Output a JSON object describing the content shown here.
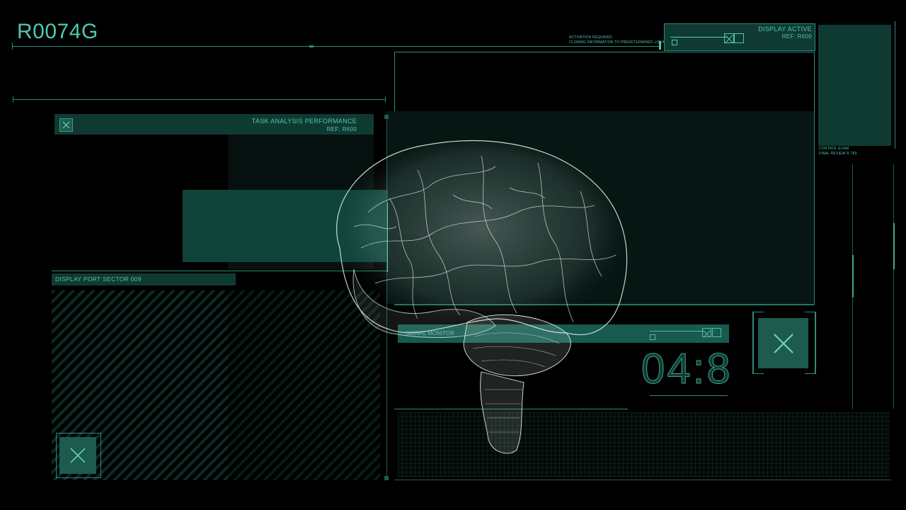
{
  "header": {
    "code": "R0074G"
  },
  "top_notice": {
    "line1": "ACTIVATION REQUIRED",
    "line2": "CLONING INFORMATION TO PREDETERMINED LOCATION"
  },
  "display_panel": {
    "title": "DISPLAY ACTIVE",
    "ref": "REF: R600"
  },
  "side_note": {
    "line1": "CONTROL EXAM",
    "line2": "FINAL REVIEW R 783"
  },
  "task_panel": {
    "title": "TASK ANALYSIS PERFORMANCE",
    "ref": "REF: R600"
  },
  "port_panel": {
    "title": "DISPLAY PORT SECTOR 009"
  },
  "signal_bar": {
    "label": "SIGNAL MONITOR"
  },
  "timer": {
    "value": "04:8"
  },
  "colors": {
    "accent": "#4fc9ad",
    "panel": "#0f3a32",
    "background": "#000000"
  },
  "icons": [
    "close-icon",
    "brain-wireframe"
  ]
}
